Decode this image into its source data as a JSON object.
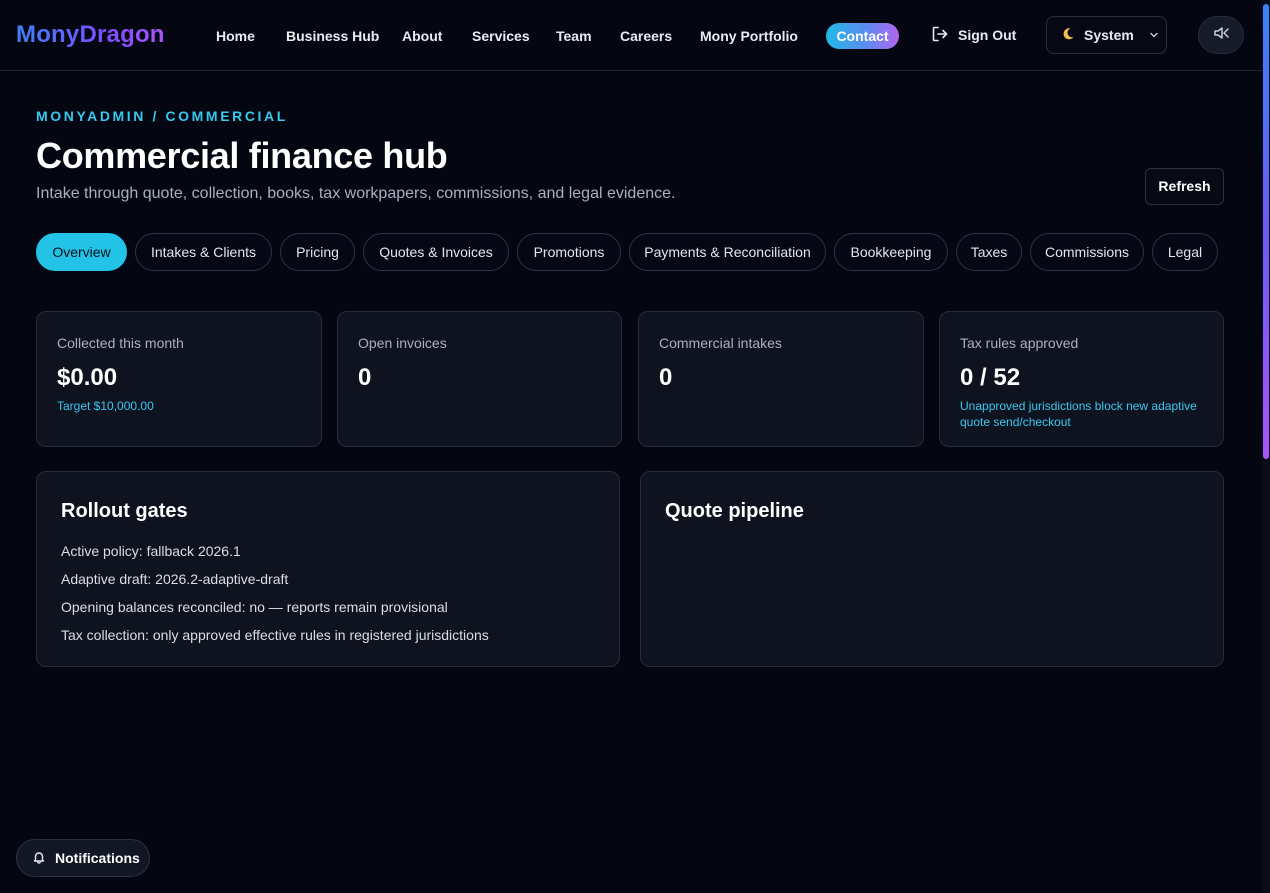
{
  "nav": {
    "logo": "MonyDragon",
    "links": [
      "Home",
      "Business Hub",
      "About",
      "Services",
      "Team",
      "Careers",
      "Mony Portfolio"
    ],
    "contact": "Contact",
    "sign_out": "Sign Out",
    "theme": "System",
    "icons": {
      "sign_out": "logout-icon",
      "theme": "moon-icon",
      "theme_menu": "chevron-down-icon",
      "sound": "speaker-mute-icon"
    }
  },
  "header": {
    "breadcrumb": "MONYADMIN / COMMERCIAL",
    "title": "Commercial finance hub",
    "subtitle": "Intake through quote, collection, books, tax workpapers, commissions, and legal evidence.",
    "refresh": "Refresh"
  },
  "tabs": [
    "Overview",
    "Intakes & Clients",
    "Pricing",
    "Quotes & Invoices",
    "Promotions",
    "Payments & Reconciliation",
    "Bookkeeping",
    "Taxes",
    "Commissions",
    "Legal"
  ],
  "active_tab": "Overview",
  "stats": [
    {
      "label": "Collected this month",
      "value": "$0.00",
      "note": "Target $10,000.00"
    },
    {
      "label": "Open invoices",
      "value": "0",
      "note": ""
    },
    {
      "label": "Commercial intakes",
      "value": "0",
      "note": ""
    },
    {
      "label": "Tax rules approved",
      "value": "0 / 52",
      "note": "Unapproved jurisdictions block new adaptive quote send/checkout"
    }
  ],
  "rollout": {
    "title": "Rollout gates",
    "lines": [
      "Active policy: fallback 2026.1",
      "Adaptive draft: 2026.2-adaptive-draft",
      "Opening balances reconciled: no — reports remain provisional",
      "Tax collection: only approved effective rules in registered jurisdictions"
    ]
  },
  "pipeline": {
    "title": "Quote pipeline"
  },
  "notifications": {
    "label": "Notifications",
    "icon": "bell-icon"
  },
  "colors": {
    "background": "#040711",
    "card": "#0f1320",
    "accent": "#22c3e6",
    "brand_start": "#3b82f6",
    "brand_end": "#a855f7"
  }
}
